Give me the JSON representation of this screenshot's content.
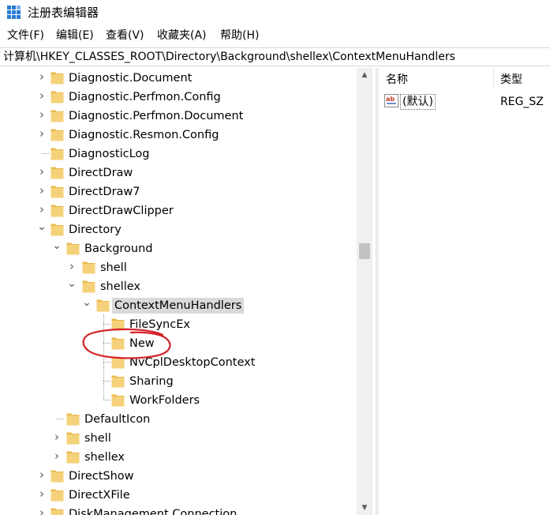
{
  "app": {
    "title": "注册表编辑器",
    "icon": "registry-editor-icon"
  },
  "menu": [
    {
      "label": "文件(F)"
    },
    {
      "label": "编辑(E)"
    },
    {
      "label": "查看(V)"
    },
    {
      "label": "收藏夹(A)"
    },
    {
      "label": "帮助(H)"
    }
  ],
  "address": {
    "path": "计算机\\HKEY_CLASSES_ROOT\\Directory\\Background\\shellex\\ContextMenuHandlers"
  },
  "tree": {
    "items": [
      {
        "label": "Diagnostic.Document",
        "expander": "collapsed",
        "level": 0
      },
      {
        "label": "Diagnostic.Perfmon.Config",
        "expander": "collapsed",
        "level": 0
      },
      {
        "label": "Diagnostic.Perfmon.Document",
        "expander": "collapsed",
        "level": 0
      },
      {
        "label": "Diagnostic.Resmon.Config",
        "expander": "collapsed",
        "level": 0
      },
      {
        "label": "DiagnosticLog",
        "expander": "none",
        "level": 0
      },
      {
        "label": "DirectDraw",
        "expander": "collapsed",
        "level": 0
      },
      {
        "label": "DirectDraw7",
        "expander": "collapsed",
        "level": 0
      },
      {
        "label": "DirectDrawClipper",
        "expander": "collapsed",
        "level": 0
      },
      {
        "label": "Directory",
        "expander": "expanded",
        "level": 0
      },
      {
        "label": "Background",
        "expander": "expanded",
        "level": 1
      },
      {
        "label": "shell",
        "expander": "collapsed",
        "level": 2
      },
      {
        "label": "shellex",
        "expander": "expanded",
        "level": 2
      },
      {
        "label": "ContextMenuHandlers",
        "expander": "expanded",
        "level": 3,
        "selected": true
      },
      {
        "label": "FileSyncEx",
        "expander": "none",
        "level": 4
      },
      {
        "label": "New",
        "expander": "none",
        "level": 4,
        "circled": true
      },
      {
        "label": "NvCplDesktopContext",
        "expander": "none",
        "level": 4
      },
      {
        "label": "Sharing",
        "expander": "none",
        "level": 4
      },
      {
        "label": "WorkFolders",
        "expander": "none",
        "level": 4
      },
      {
        "label": "DefaultIcon",
        "expander": "none",
        "level": 1
      },
      {
        "label": "shell",
        "expander": "collapsed",
        "level": 1
      },
      {
        "label": "shellex",
        "expander": "collapsed",
        "level": 1
      },
      {
        "label": "DirectShow",
        "expander": "collapsed",
        "level": 0
      },
      {
        "label": "DirectXFile",
        "expander": "collapsed",
        "level": 0
      },
      {
        "label": "DiskManagement.Connection",
        "expander": "collapsed",
        "level": 0
      }
    ]
  },
  "values": {
    "headers": {
      "name": "名称",
      "type": "类型"
    },
    "rows": [
      {
        "name": "(默认)",
        "type": "REG_SZ",
        "icon": "string-value-icon"
      }
    ]
  },
  "colors": {
    "selection": "#d9d9d9",
    "folder": "#f5d27a",
    "annotation": "#d4242b"
  }
}
